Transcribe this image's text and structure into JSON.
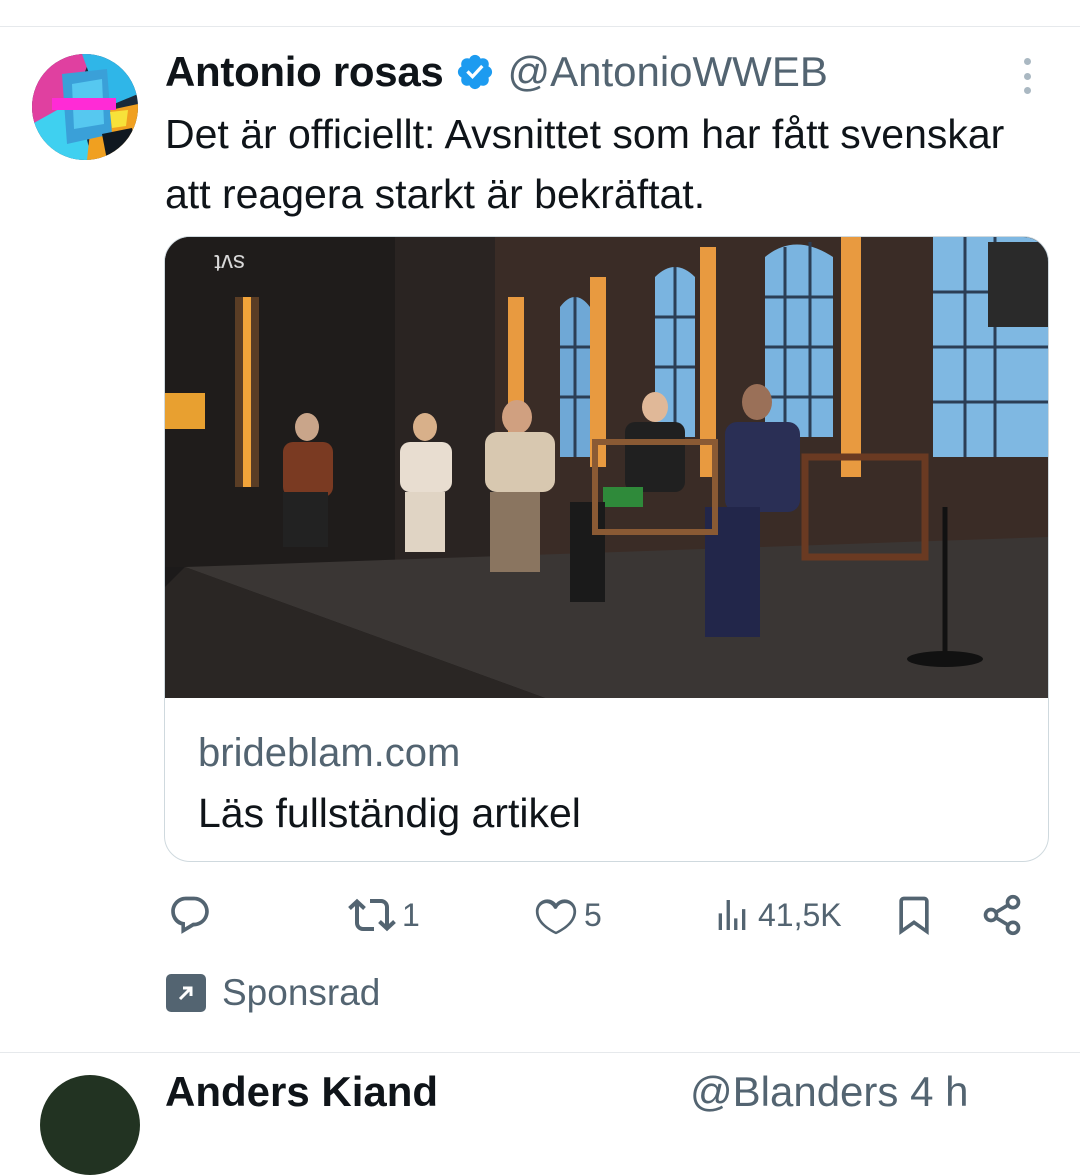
{
  "tweet": {
    "author_name": "Antonio rosas",
    "handle": "@AntonioWWEB",
    "text": "Det är officiellt: Avsnittet som har fått svenskar att reagera starkt är bekräftat.",
    "card": {
      "image_watermark": "svt",
      "domain": "brideblam.com",
      "title": "Läs fullständig artikel"
    },
    "actions": {
      "replies": "",
      "retweets": "1",
      "likes": "5",
      "views": "41,5K"
    },
    "sponsored_label": "Sponsrad"
  },
  "next_tweet": {
    "author_name": "Anders Kiand",
    "handle": "@Blanders 4 h"
  },
  "colors": {
    "verified": "#1d9bf0",
    "secondary_text": "#536471",
    "border": "#cfd9de"
  }
}
